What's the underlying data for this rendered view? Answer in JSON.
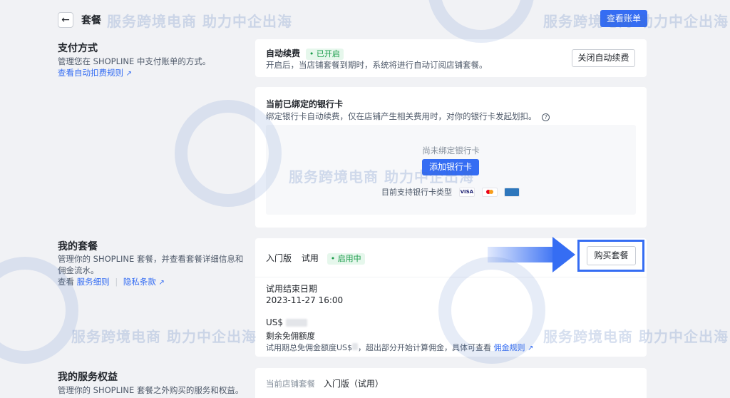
{
  "header": {
    "back_icon": "←",
    "title": "套餐",
    "view_bill": "查看账单"
  },
  "payment": {
    "title": "支付方式",
    "desc": "管理您在 SHOPLINE 中支付账单的方式。",
    "link": "查看自动扣费规则",
    "auto_renew_label": "自动续费",
    "auto_renew_status": "已开启",
    "auto_renew_desc": "开启后，当店铺套餐到期时，系统将进行自动订阅店铺套餐。",
    "close_auto_renew": "关闭自动续费",
    "bank_title": "当前已绑定的银行卡",
    "bank_desc": "绑定银行卡自动续费，仅在店铺产生相关费用时，对你的银行卡发起划扣。",
    "help_icon": "?",
    "no_card": "尚未绑定银行卡",
    "add_card": "添加银行卡",
    "supported_types": "目前支持银行卡类型",
    "card_visa": "VISA"
  },
  "plan": {
    "title": "我的套餐",
    "desc": "管理你的 SHOPLINE 套餐，并查看套餐详细信息和佣金流水。",
    "view_prefix": "查看",
    "details_link": "服务细则",
    "separator": "|",
    "privacy_link": "隐私条款",
    "name": "入门版",
    "trial": "试用",
    "status": "启用中",
    "buy": "购买套餐",
    "trial_end_label": "试用结束日期",
    "trial_end_value": "2023-11-27 16:00",
    "currency": "US$",
    "free_quota_label": "剩余免佣额度",
    "free_quota_desc": "试用期总免佣金额度US$",
    "free_quota_desc2": "，超出部分开始计算佣金，具体可查看",
    "commission_link": "佣金规则"
  },
  "services": {
    "title": "我的服务权益",
    "desc": "管理你的 SHOPLINE 套餐之外购买的服务和权益。",
    "current_label": "当前店铺套餐",
    "current_value": "入门版（试用）"
  },
  "watermark": {
    "text": "服务跨境电商  助力中企出海"
  }
}
